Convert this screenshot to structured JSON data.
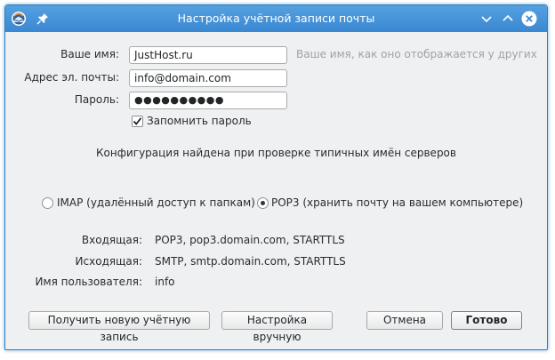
{
  "window": {
    "title": "Настройка учётной записи почты"
  },
  "form": {
    "name_label": "Ваше имя:",
    "name_value": "JustHost.ru",
    "name_hint": "Ваше имя, как оно отображается у других",
    "email_label": "Адрес эл. почты:",
    "email_value": "info@domain.com",
    "password_label": "Пароль:",
    "password_value": "●●●●●●●●●●",
    "remember_label": "Запомнить пароль",
    "remember_checked": true
  },
  "status": {
    "message": "Конфигурация найдена при проверке типичных имён серверов"
  },
  "protocol": {
    "imap_label": "IMAP (удалённый доступ к папкам)",
    "pop3_label": "POP3 (хранить почту на вашем компьютере)",
    "selected": "POP3"
  },
  "servers": {
    "incoming_label": "Входящая:",
    "incoming_value": "POP3, pop3.domain.com, STARTTLS",
    "outgoing_label": "Исходящая:",
    "outgoing_value": "SMTP, smtp.domain.com, STARTTLS",
    "username_label": "Имя пользователя:",
    "username_value": "info"
  },
  "buttons": {
    "new_account": "Получить новую учётную запись",
    "manual": "Настройка вручную",
    "cancel": "Отмена",
    "done": "Готово"
  },
  "colors": {
    "titlebar": "#3d8bd4",
    "window_bg": "#eff0f1"
  }
}
